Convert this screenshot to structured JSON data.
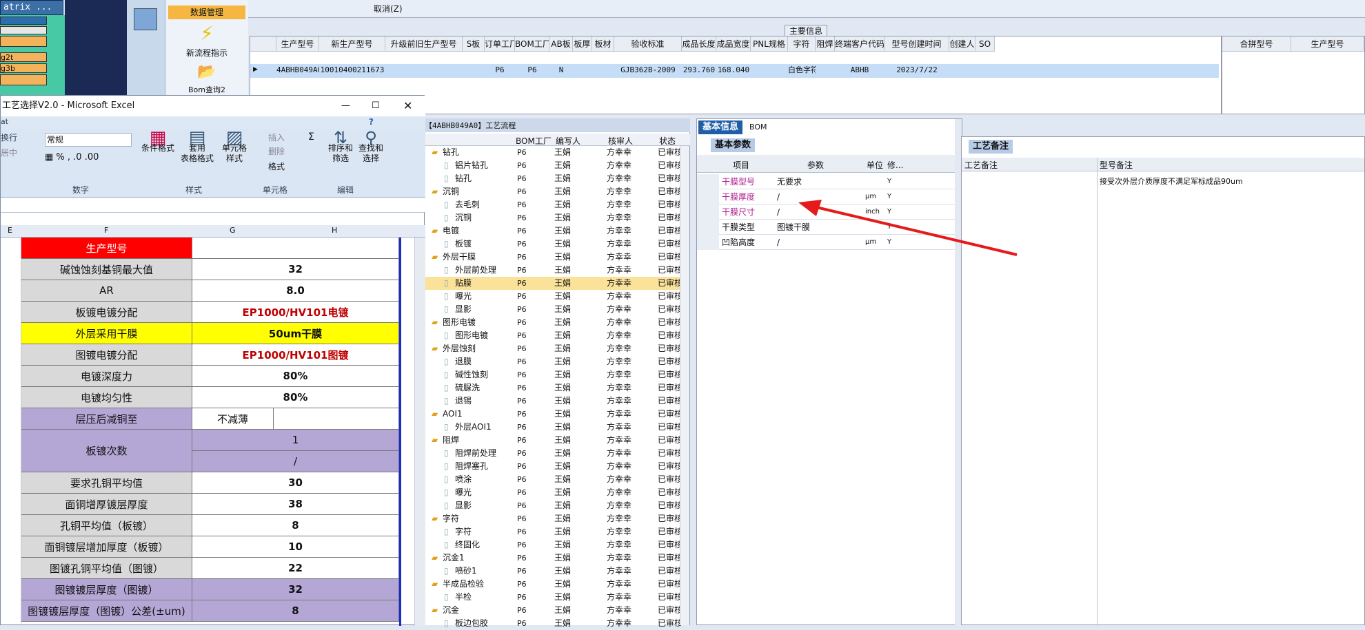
{
  "bg_app": {
    "matrix_label": "atrix ...",
    "labels": [
      "g2t",
      "g3b"
    ]
  },
  "menu": {
    "data_mgmt": "数据管理",
    "new_flow": "新流程指示",
    "bom_query": "Bom查询2"
  },
  "topbar": {
    "cancel": "取消(Z)"
  },
  "main_info": {
    "title": "主要信息",
    "columns": [
      "生产型号",
      "新生产型号",
      "升级前旧生产型号",
      "S板",
      "订单工厂",
      "BOM工厂",
      "AB板",
      "板厚",
      "板材",
      "验收标准",
      "成品长度",
      "成品宽度",
      "PNL规格",
      "字符",
      "阻焊",
      "终端客户代码",
      "型号创建时间",
      "创建人",
      "SO"
    ],
    "row": [
      "4ABHB049A0",
      "10010400211673",
      "",
      "",
      "P6",
      "P6",
      "N",
      "",
      "",
      "GJB362B-2009",
      "293.760",
      "168.040",
      "",
      "白色字符",
      "",
      "ABHB",
      "2023/7/22",
      "",
      ""
    ]
  },
  "merge": {
    "columns": [
      "合拼型号",
      "生产型号"
    ]
  },
  "excel": {
    "title": "工艺选择V2.0 - Microsoft Excel",
    "ribbon_left": [
      "换行",
      "居中"
    ],
    "number_format": "常规",
    "groups": {
      "number": "数字",
      "style": "样式",
      "cells": "单元格",
      "edit": "编辑"
    },
    "buttons": [
      "条件格式",
      "套用\n表格格式",
      "单元格\n样式",
      "插入",
      "删除",
      "格式",
      "排序和\n筛选",
      "查找和\n选择"
    ],
    "cols": [
      "E",
      "F",
      "G",
      "H"
    ],
    "rows": [
      {
        "label": "生产型号",
        "value": "",
        "lbg": "#ff0000",
        "lcolor": "#ffffff",
        "vbg": "#ffffff",
        "vcolor": "#111"
      },
      {
        "label": "碱蚀蚀刻基铜最大值",
        "value": "32",
        "lbg": "#d9d9d9",
        "vbg": "#ffffff",
        "vcolor": "#111"
      },
      {
        "label": "AR",
        "value": "8.0",
        "lbg": "#d9d9d9",
        "vbg": "#ffffff",
        "vcolor": "#111"
      },
      {
        "label": "板镀电镀分配",
        "value": "EP1000/HV101电镀",
        "lbg": "#d9d9d9",
        "vbg": "#ffffff",
        "vcolor": "#c00000"
      },
      {
        "label": "外层采用干膜",
        "value": "50um干膜",
        "lbg": "#ffff00",
        "vbg": "#ffff00",
        "vcolor": "#111"
      },
      {
        "label": "图镀电镀分配",
        "value": "EP1000/HV101图镀",
        "lbg": "#d9d9d9",
        "vbg": "#ffffff",
        "vcolor": "#c00000"
      },
      {
        "label": "电镀深度力",
        "value": "80%",
        "lbg": "#d9d9d9",
        "vbg": "#ffffff",
        "vcolor": "#111"
      },
      {
        "label": "电镀均匀性",
        "value": "80%",
        "lbg": "#d9d9d9",
        "vbg": "#ffffff",
        "vcolor": "#111"
      }
    ],
    "row_press": {
      "label": "层压后减铜至",
      "value": "不减薄"
    },
    "row_plating": {
      "label": "板镀次数",
      "v1": "1",
      "v2": "/"
    },
    "rows2": [
      {
        "label": "要求孔铜平均值",
        "value": "30",
        "lbg": "#d9d9d9",
        "vbg": "#ffffff"
      },
      {
        "label": "面铜增厚镀层厚度",
        "value": "38",
        "lbg": "#d9d9d9",
        "vbg": "#ffffff"
      },
      {
        "label": "孔铜平均值（板镀）",
        "value": "8",
        "lbg": "#d9d9d9",
        "vbg": "#ffffff"
      },
      {
        "label": "面铜镀层增加厚度（板镀）",
        "value": "10",
        "lbg": "#d9d9d9",
        "vbg": "#ffffff"
      },
      {
        "label": "图镀孔铜平均值（图镀）",
        "value": "22",
        "lbg": "#d9d9d9",
        "vbg": "#ffffff"
      },
      {
        "label": "图镀镀层厚度（图镀）",
        "value": "32",
        "lbg": "#b4a7d6",
        "vbg": "#b4a7d6"
      },
      {
        "label": "图镀镀层厚度（图镀）公差(±um)",
        "value": "8",
        "lbg": "#b4a7d6",
        "vbg": "#b4a7d6"
      }
    ]
  },
  "process": {
    "tab": "【4ABHB049A0】工艺流程",
    "headers": [
      "BOM工厂",
      "编写人",
      "核审人",
      "状态"
    ],
    "rows": [
      {
        "n": "钻孔",
        "lvl": 0,
        "f": "P6",
        "w": "王娟",
        "r": "方幸幸",
        "s": "已审核"
      },
      {
        "n": "铝片钻孔",
        "lvl": 1,
        "f": "P6",
        "w": "王娟",
        "r": "方幸幸",
        "s": "已审核"
      },
      {
        "n": "钻孔",
        "lvl": 1,
        "f": "P6",
        "w": "王娟",
        "r": "方幸幸",
        "s": "已审核"
      },
      {
        "n": "沉铜",
        "lvl": 0,
        "f": "P6",
        "w": "王娟",
        "r": "方幸幸",
        "s": "已审核"
      },
      {
        "n": "去毛刺",
        "lvl": 1,
        "f": "P6",
        "w": "王娟",
        "r": "方幸幸",
        "s": "已审核"
      },
      {
        "n": "沉铜",
        "lvl": 1,
        "f": "P6",
        "w": "王娟",
        "r": "方幸幸",
        "s": "已审核"
      },
      {
        "n": "电镀",
        "lvl": 0,
        "f": "P6",
        "w": "王娟",
        "r": "方幸幸",
        "s": "已审核"
      },
      {
        "n": "板镀",
        "lvl": 1,
        "f": "P6",
        "w": "王娟",
        "r": "方幸幸",
        "s": "已审核"
      },
      {
        "n": "外层干膜",
        "lvl": 0,
        "f": "P6",
        "w": "王娟",
        "r": "方幸幸",
        "s": "已审核"
      },
      {
        "n": "外层前处理",
        "lvl": 1,
        "f": "P6",
        "w": "王娟",
        "r": "方幸幸",
        "s": "已审核"
      },
      {
        "n": "贴膜",
        "lvl": 1,
        "f": "P6",
        "w": "王娟",
        "r": "方幸幸",
        "s": "已审核",
        "sel": true
      },
      {
        "n": "曝光",
        "lvl": 1,
        "f": "P6",
        "w": "王娟",
        "r": "方幸幸",
        "s": "已审核"
      },
      {
        "n": "显影",
        "lvl": 1,
        "f": "P6",
        "w": "王娟",
        "r": "方幸幸",
        "s": "已审核"
      },
      {
        "n": "图形电镀",
        "lvl": 0,
        "f": "P6",
        "w": "王娟",
        "r": "方幸幸",
        "s": "已审核"
      },
      {
        "n": "图形电镀",
        "lvl": 1,
        "f": "P6",
        "w": "王娟",
        "r": "方幸幸",
        "s": "已审核"
      },
      {
        "n": "外层蚀刻",
        "lvl": 0,
        "f": "P6",
        "w": "王娟",
        "r": "方幸幸",
        "s": "已审核"
      },
      {
        "n": "退膜",
        "lvl": 1,
        "f": "P6",
        "w": "王娟",
        "r": "方幸幸",
        "s": "已审核"
      },
      {
        "n": "碱性蚀刻",
        "lvl": 1,
        "f": "P6",
        "w": "王娟",
        "r": "方幸幸",
        "s": "已审核"
      },
      {
        "n": "硫脲洗",
        "lvl": 1,
        "f": "P6",
        "w": "王娟",
        "r": "方幸幸",
        "s": "已审核"
      },
      {
        "n": "退锡",
        "lvl": 1,
        "f": "P6",
        "w": "王娟",
        "r": "方幸幸",
        "s": "已审核"
      },
      {
        "n": "AOI1",
        "lvl": 0,
        "f": "P6",
        "w": "王娟",
        "r": "方幸幸",
        "s": "已审核"
      },
      {
        "n": "外层AOI1",
        "lvl": 1,
        "f": "P6",
        "w": "王娟",
        "r": "方幸幸",
        "s": "已审核"
      },
      {
        "n": "阻焊",
        "lvl": 0,
        "f": "P6",
        "w": "王娟",
        "r": "方幸幸",
        "s": "已审核"
      },
      {
        "n": "阻焊前处理",
        "lvl": 1,
        "f": "P6",
        "w": "王娟",
        "r": "方幸幸",
        "s": "已审核"
      },
      {
        "n": "阻焊塞孔",
        "lvl": 1,
        "f": "P6",
        "w": "王娟",
        "r": "方幸幸",
        "s": "已审核"
      },
      {
        "n": "喷涂",
        "lvl": 1,
        "f": "P6",
        "w": "王娟",
        "r": "方幸幸",
        "s": "已审核"
      },
      {
        "n": "曝光",
        "lvl": 1,
        "f": "P6",
        "w": "王娟",
        "r": "方幸幸",
        "s": "已审核"
      },
      {
        "n": "显影",
        "lvl": 1,
        "f": "P6",
        "w": "王娟",
        "r": "方幸幸",
        "s": "已审核"
      },
      {
        "n": "字符",
        "lvl": 0,
        "f": "P6",
        "w": "王娟",
        "r": "方幸幸",
        "s": "已审核"
      },
      {
        "n": "字符",
        "lvl": 1,
        "f": "P6",
        "w": "王娟",
        "r": "方幸幸",
        "s": "已审核"
      },
      {
        "n": "终固化",
        "lvl": 1,
        "f": "P6",
        "w": "王娟",
        "r": "方幸幸",
        "s": "已审核"
      },
      {
        "n": "沉金1",
        "lvl": 0,
        "f": "P6",
        "w": "王娟",
        "r": "方幸幸",
        "s": "已审核"
      },
      {
        "n": "喷砂1",
        "lvl": 1,
        "f": "P6",
        "w": "王娟",
        "r": "方幸幸",
        "s": "已审核"
      },
      {
        "n": "半成品检验",
        "lvl": 0,
        "f": "P6",
        "w": "王娟",
        "r": "方幸幸",
        "s": "已审核"
      },
      {
        "n": "半检",
        "lvl": 1,
        "f": "P6",
        "w": "王娟",
        "r": "方幸幸",
        "s": "已审核"
      },
      {
        "n": "沉金",
        "lvl": 0,
        "f": "P6",
        "w": "王娟",
        "r": "方幸幸",
        "s": "已审核"
      },
      {
        "n": "板边包胶",
        "lvl": 1,
        "f": "P6",
        "w": "王娟",
        "r": "方幸幸",
        "s": "已审核"
      }
    ]
  },
  "basic_info": {
    "tabs": [
      "基本信息",
      "BOM"
    ],
    "subtab": "基本参数",
    "headers": [
      "项目",
      "参数",
      "单位",
      "修..."
    ],
    "rows": [
      {
        "item": "干膜型号",
        "param": "无要求",
        "unit": "",
        "mod": "Y",
        "color": "#b0208f"
      },
      {
        "item": "干膜厚度",
        "param": "/",
        "unit": "μm",
        "mod": "Y",
        "color": "#b0208f"
      },
      {
        "item": "干膜尺寸",
        "param": "/",
        "unit": "inch",
        "mod": "Y",
        "color": "#b0208f"
      },
      {
        "item": "干膜类型",
        "param": "图镀干膜",
        "unit": "",
        "mod": "Y",
        "color": "#111111"
      },
      {
        "item": "凹陷高度",
        "param": "/",
        "unit": "μm",
        "mod": "Y",
        "color": "#111111"
      }
    ]
  },
  "craft_notes": {
    "tab": "工艺备注",
    "headers": [
      "工艺备注",
      "型号备注"
    ],
    "model_note": "接受次外层介质厚度不满足军标成品90um"
  }
}
